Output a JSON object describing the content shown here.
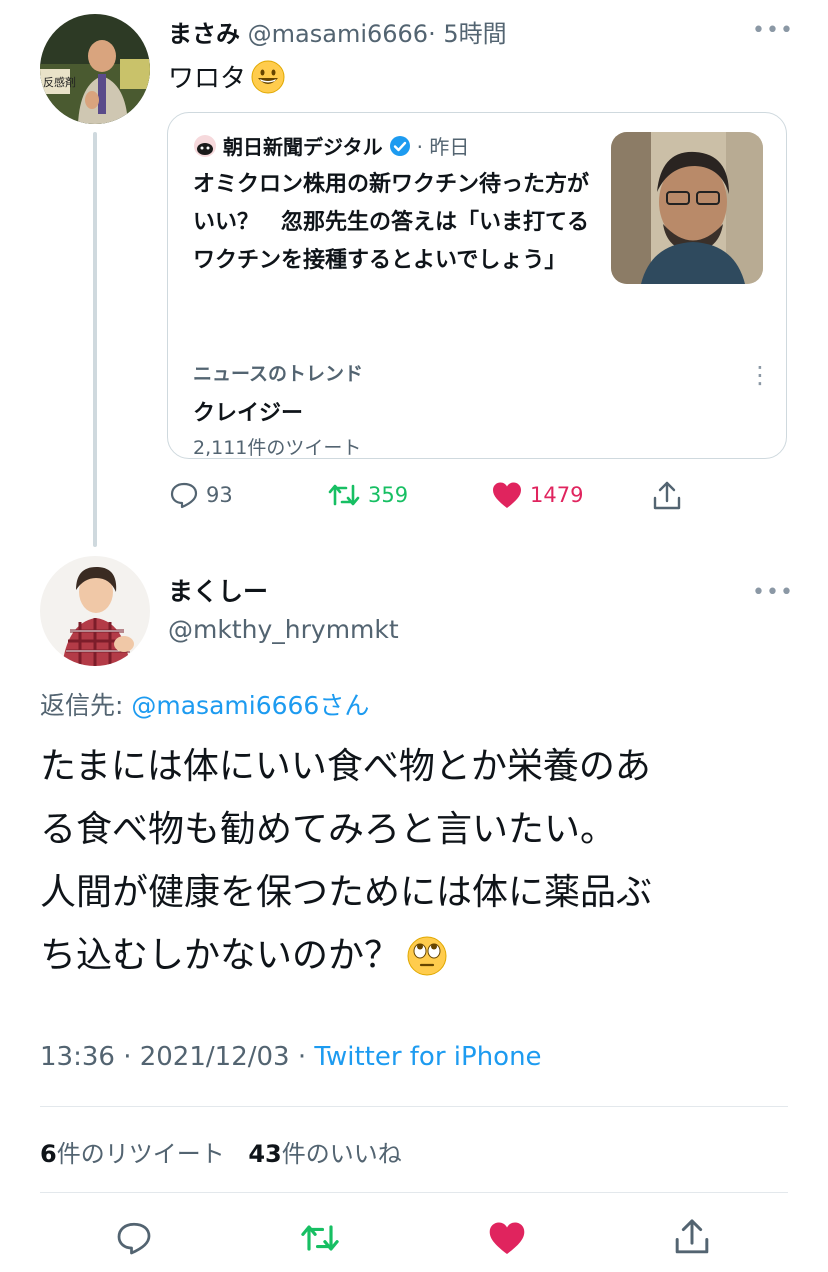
{
  "tweet1": {
    "name": "まさみ",
    "handle": "@masami6666",
    "time": "· 5時間",
    "text": "ワロタ",
    "more": "•••",
    "quote": {
      "source": "朝日新聞デジタル",
      "time": "· 昨日",
      "headline": "オミクロン株用の新ワクチン待った方がいい？　忽那先生の答えは「いま打てるワクチンを接種するとよいでしょう」",
      "trend_label": "ニュースのトレンド",
      "trend_title": "クレイジー",
      "trend_count": "2,111件のツイート",
      "trend_more": "⋮"
    },
    "stats": {
      "replies": "93",
      "retweets": "359",
      "likes": "1479"
    }
  },
  "tweet2": {
    "name": "まくしー",
    "handle": "@mkthy_hrymmkt",
    "more": "•••",
    "reply_prefix": "返信先: ",
    "reply_to": "@masami6666さん",
    "text_line1": "たまには体にいい食べ物とか栄養のあ",
    "text_line2": "る食べ物も勧めてみろと言いたい。",
    "text_line3": "人間が健康を保つためには体に薬品ぶ",
    "text_line4": "ち込むしかないのか？",
    "time": "13:36 · 2021/12/03 · ",
    "client": "Twitter for iPhone",
    "retweet_count": "6",
    "retweet_label": "件のリツイート",
    "like_count": "43",
    "like_label": "件のいいね"
  },
  "colors": {
    "retweet": "#17bf63",
    "like": "#e0245e",
    "link": "#1d9bf0",
    "muted": "#536471"
  }
}
